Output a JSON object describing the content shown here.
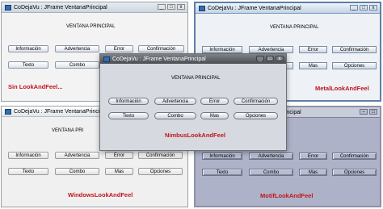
{
  "window_title": "CoDejaVu : JFrame VentanaPrincipal",
  "heading": "VENTANA PRINCIPAL",
  "heading_truncated": "VENTANA PRI",
  "buttons": {
    "informacion": "Información",
    "advertencia": "Advertencia",
    "error": "Error",
    "confirmacion": "Confirmación",
    "texto": "Texto",
    "combo": "Combo",
    "mas": "Mas",
    "opciones": "Opciones"
  },
  "captions": {
    "default": "Sin LookAndFeel...",
    "metal": "MetalLookAndFeel",
    "nimbus": "NimbusLookAndFeel",
    "windows": "WindowsLookAndFeel",
    "motif": "MotifLookAndFeel"
  },
  "colors": {
    "caption_red": "#c0151b",
    "metal_border": "#5d7fa6",
    "nimbus_title": "#4b4e53",
    "motif_background": "#aeb2c8"
  }
}
